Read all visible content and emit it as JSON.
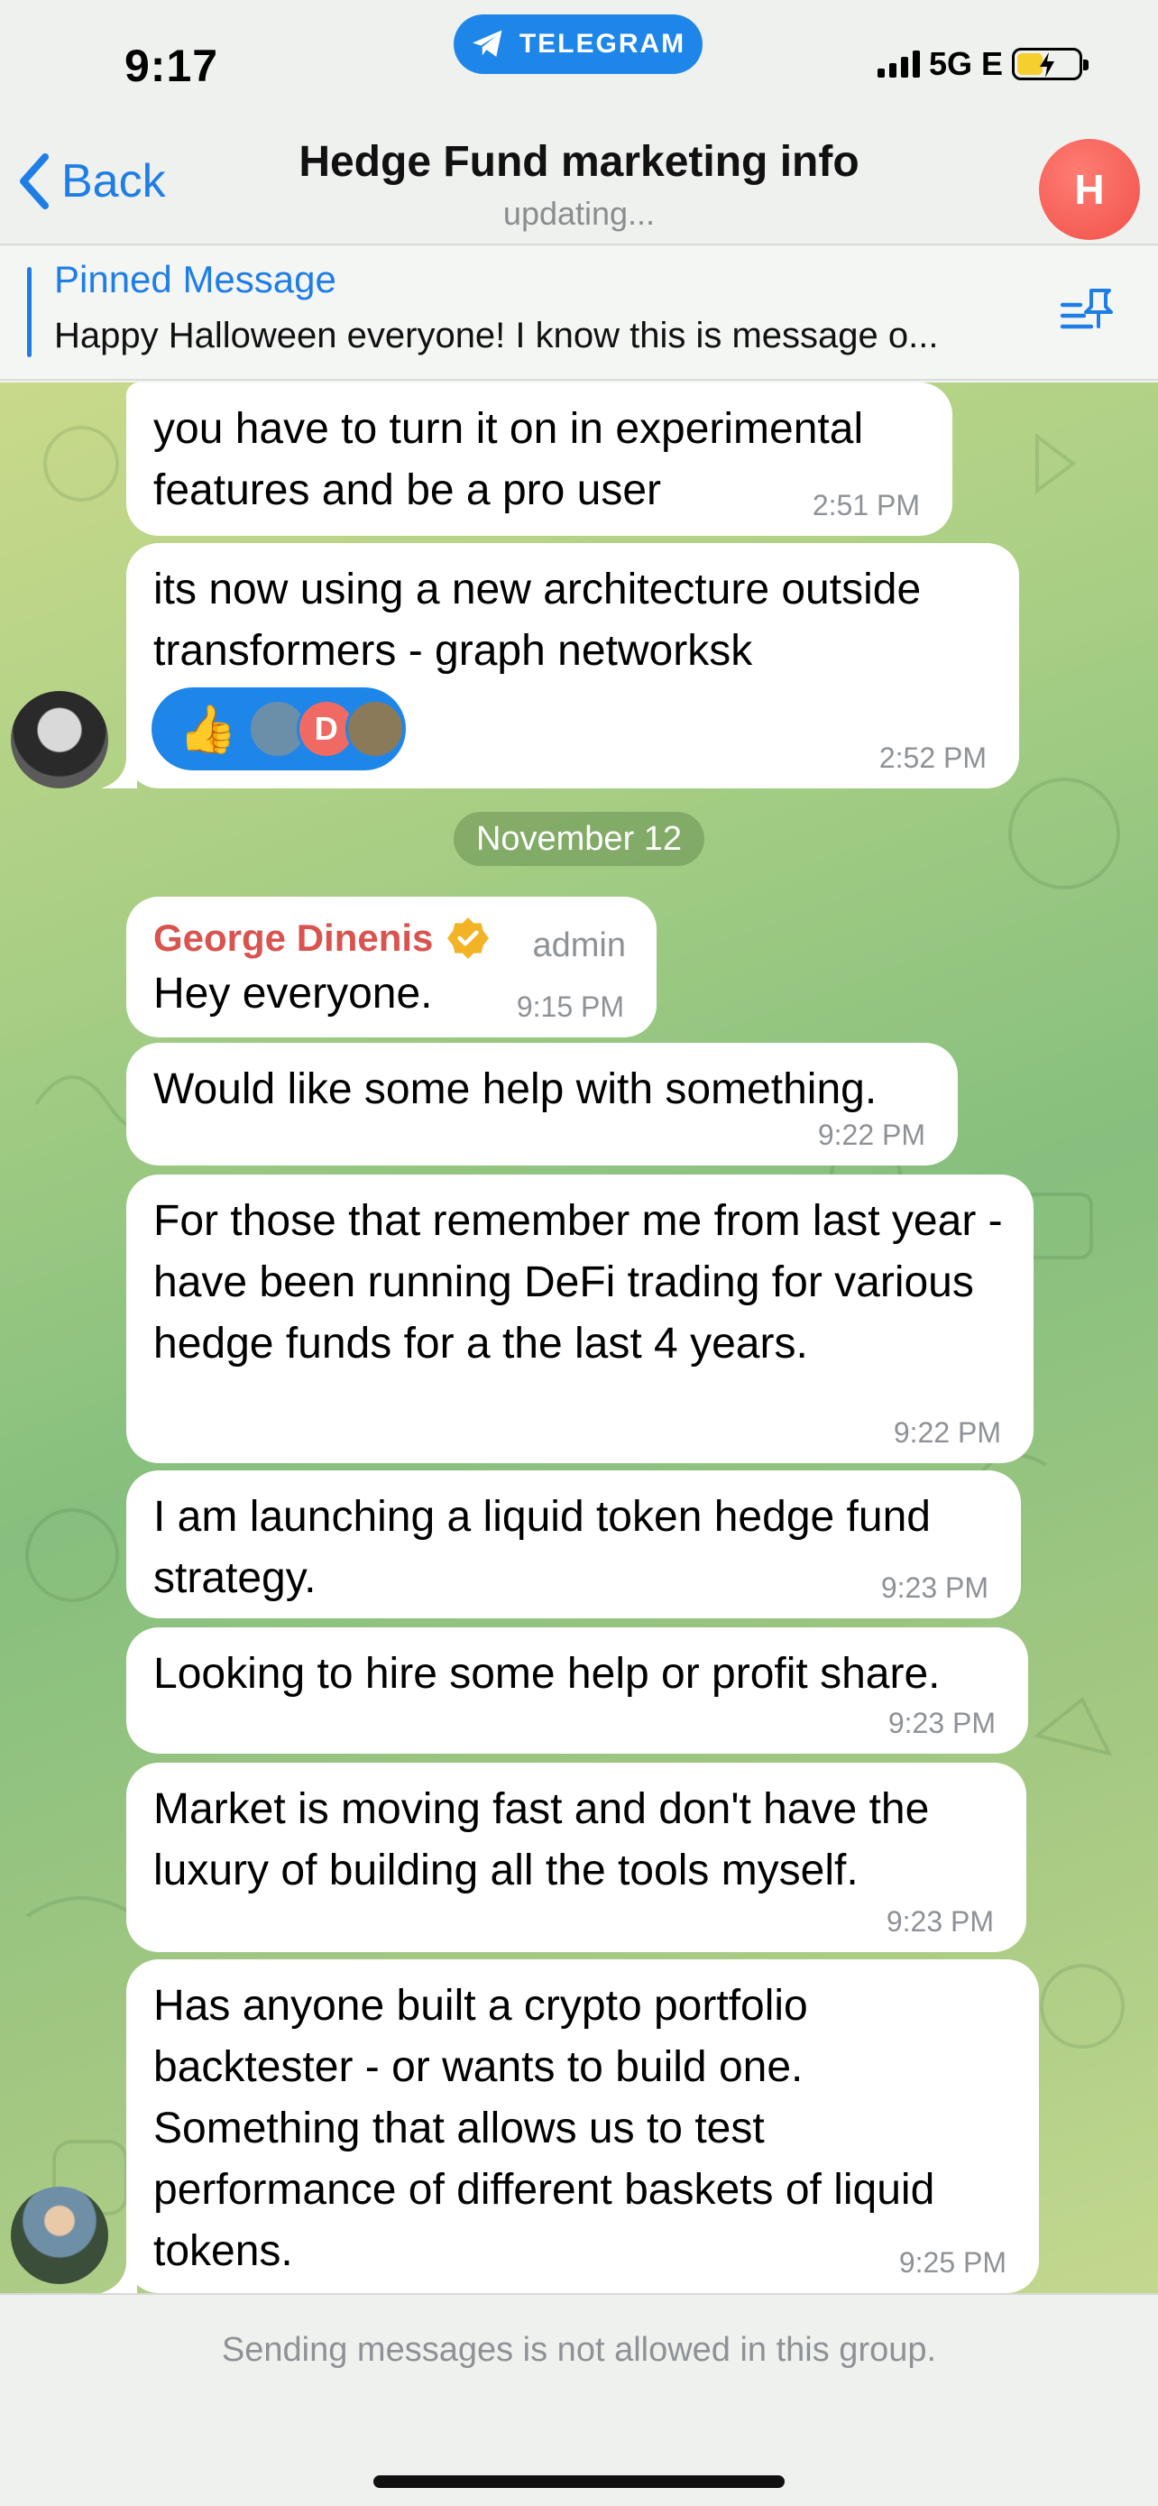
{
  "status": {
    "time": "9:17",
    "network": "5G E",
    "pill_label": "TELEGRAM"
  },
  "header": {
    "back_label": "Back",
    "title": "Hedge Fund marketing info",
    "subtitle": "updating...",
    "avatar_letter": "H"
  },
  "pinned": {
    "title": "Pinned Message",
    "text": "Happy Halloween everyone! I know this is message o..."
  },
  "date_chip": "November 12",
  "messages": [
    {
      "text": "you have to turn it on in experimental features and be a pro user",
      "time": "2:51 PM"
    },
    {
      "text": "its now using a new architecture outside transformers - graph networksk",
      "time": "2:52 PM",
      "reaction_emoji": "👍",
      "reaction_avatar_letter": "D"
    },
    {
      "sender": "George Dinenis",
      "role": "admin",
      "text": "Hey everyone.",
      "time": "9:15 PM"
    },
    {
      "text": "Would like some help with something.",
      "time": "9:22 PM"
    },
    {
      "text": "For those that remember me from last year - have been running DeFi trading for various hedge funds for a the last 4 years.",
      "time": "9:22 PM"
    },
    {
      "text": "I am launching a liquid token hedge fund strategy.",
      "time": "9:23 PM"
    },
    {
      "text": "Looking to hire some help or profit share.",
      "time": "9:23 PM"
    },
    {
      "text": "Market is moving fast and don't have the luxury of building all the tools myself.",
      "time": "9:23 PM"
    },
    {
      "text": "Has anyone built a crypto portfolio backtester - or wants to build one. Something that allows us to test performance of different baskets of liquid tokens.",
      "time": "9:25 PM"
    }
  ],
  "footer": {
    "notice": "Sending messages is not allowed in this group."
  },
  "colors": {
    "accent": "#1f7ee6",
    "sender": "#d9534f",
    "pill": "#1e86e8",
    "avatar": "#f05149"
  }
}
